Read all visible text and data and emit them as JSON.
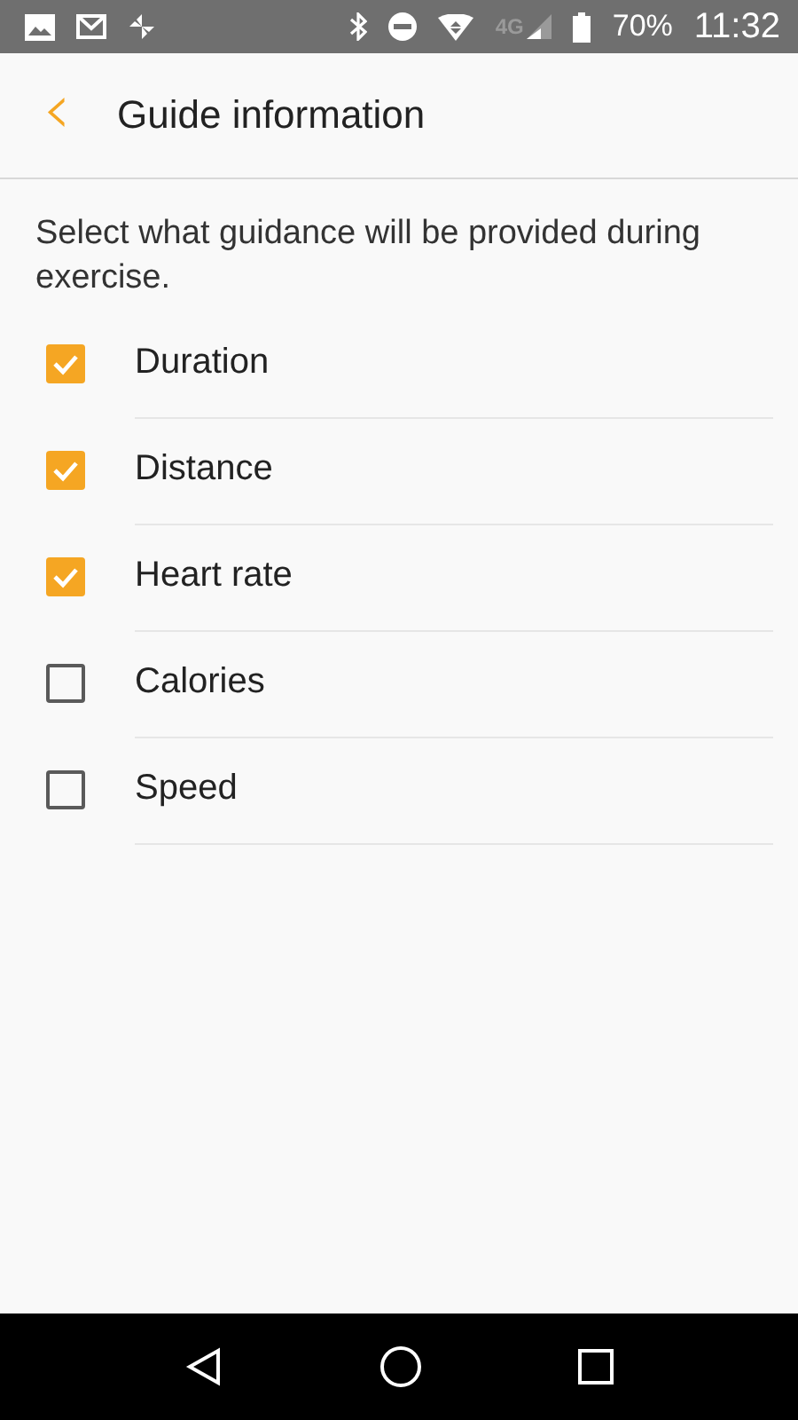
{
  "status_bar": {
    "network": "4G",
    "battery": "70%",
    "time": "11:32"
  },
  "header": {
    "back": "‹",
    "title": "Guide information"
  },
  "description": "Select what guidance will be provided during exercise.",
  "options": [
    {
      "label": "Duration",
      "checked": true
    },
    {
      "label": "Distance",
      "checked": true
    },
    {
      "label": "Heart rate",
      "checked": true
    },
    {
      "label": "Calories",
      "checked": false
    },
    {
      "label": "Speed",
      "checked": false
    }
  ]
}
